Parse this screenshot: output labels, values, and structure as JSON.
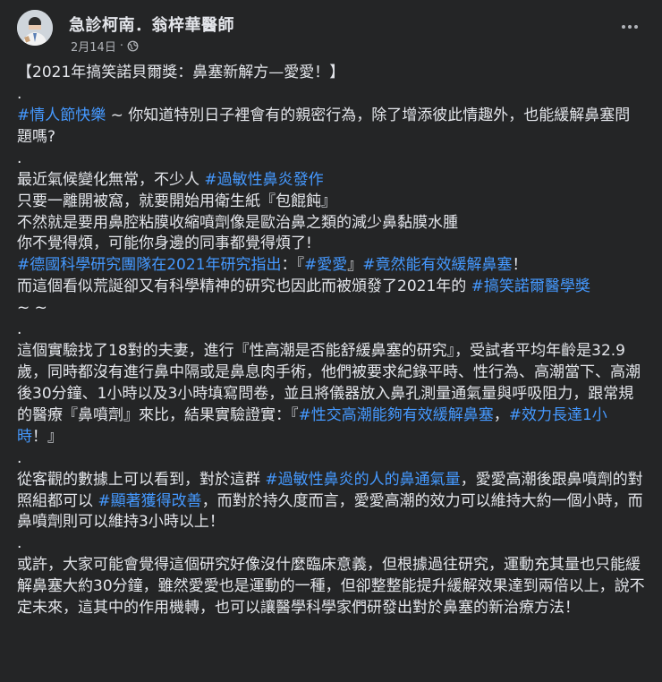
{
  "post": {
    "author": "急診柯南．翁梓華醫師",
    "date": "2月14日",
    "separator": "·",
    "privacy_icon": "globe-icon",
    "more_icon": "more-options-icon",
    "accent_color": "#4599ff"
  },
  "body": {
    "title": "【2021年搞笑諾貝爾獎：鼻塞新解方—愛愛！】",
    "dot": ".",
    "p1": {
      "tag": "#情人節快樂",
      "text": "~ 你知道特別日子裡會有的親密行為，除了增添彼此情趣外，也能緩解鼻塞問題嗎?"
    },
    "p2": {
      "l1_text": "最近氣候變化無常，不少人 ",
      "l1_tag": "#過敏性鼻炎發作",
      "l2": "只要一離開被窩，就要開始用衛生紙『包餛飩』",
      "l3": "不然就是要用鼻腔粘膜收縮噴劑像是歐治鼻之類的減少鼻黏膜水腫",
      "l4": "你不覺得煩，可能你身邊的同事都覺得煩了!",
      "l5_tag1": "#德國科學研究團隊在2021年研究指出",
      "l5_t1": "：『",
      "l5_tag2": "#愛愛",
      "l5_t2": "』",
      "l5_tag3": "#竟然能有效緩解鼻塞",
      "l5_t3": "！",
      "l6_text": "而這個看似荒誕卻又有科學精神的研究也因此而被頒發了2021年的 ",
      "l6_tag": "#搞笑諾爾醫學獎",
      "l6_tail": "~ ~"
    },
    "p3": {
      "text": "這個實驗找了18對的夫妻，進行『性高潮是否能舒緩鼻塞的研究』，受試者平均年齡是32.9歲，同時都沒有進行鼻中隔或是鼻息肉手術，他們被要求紀錄平時、性行為、高潮當下、高潮後30分鐘、1小時以及3小時填寫問卷，並且將儀器放入鼻孔測量通氣量與呼吸阻力，跟常規的醫療『鼻噴劑』來比，結果實驗證實：『",
      "tag1": "#性交高潮能夠有效緩解鼻塞",
      "mid": "，",
      "tag2": "#效力長達1小時",
      "end": "！』"
    },
    "p4": {
      "t1": "從客觀的數據上可以看到，對於這群 ",
      "tag1": "#過敏性鼻炎的人的鼻通氣量",
      "t2": "，愛愛高潮後跟鼻噴劑的對照組都可以 ",
      "tag2": "#顯著獲得改善",
      "t3": "，而對於持久度而言，愛愛高潮的效力可以維持大約一個小時，而鼻噴劑則可以維持3小時以上！"
    },
    "p5": {
      "text": "或許，大家可能會覺得這個研究好像沒什麼臨床意義，但根據過往研究，運動充其量也只能緩解鼻塞大約30分鐘，雖然愛愛也是運動的一種，但卻整整能提升緩解效果達到兩倍以上，說不定未來，這其中的作用機轉，也可以讓醫學科學家們研發出對於鼻塞的新治療方法！"
    }
  }
}
